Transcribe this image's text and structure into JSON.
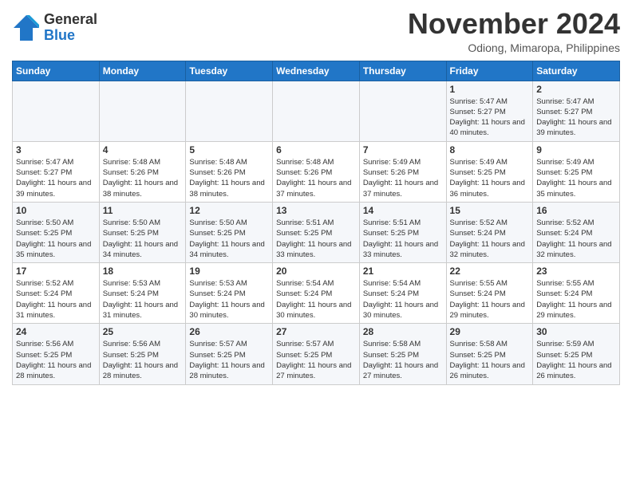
{
  "logo": {
    "general": "General",
    "blue": "Blue"
  },
  "header": {
    "month": "November 2024",
    "location": "Odiong, Mimaropa, Philippines"
  },
  "weekdays": [
    "Sunday",
    "Monday",
    "Tuesday",
    "Wednesday",
    "Thursday",
    "Friday",
    "Saturday"
  ],
  "weeks": [
    [
      {
        "day": "",
        "sunrise": "",
        "sunset": "",
        "daylight": ""
      },
      {
        "day": "",
        "sunrise": "",
        "sunset": "",
        "daylight": ""
      },
      {
        "day": "",
        "sunrise": "",
        "sunset": "",
        "daylight": ""
      },
      {
        "day": "",
        "sunrise": "",
        "sunset": "",
        "daylight": ""
      },
      {
        "day": "",
        "sunrise": "",
        "sunset": "",
        "daylight": ""
      },
      {
        "day": "1",
        "sunrise": "Sunrise: 5:47 AM",
        "sunset": "Sunset: 5:27 PM",
        "daylight": "Daylight: 11 hours and 40 minutes."
      },
      {
        "day": "2",
        "sunrise": "Sunrise: 5:47 AM",
        "sunset": "Sunset: 5:27 PM",
        "daylight": "Daylight: 11 hours and 39 minutes."
      }
    ],
    [
      {
        "day": "3",
        "sunrise": "Sunrise: 5:47 AM",
        "sunset": "Sunset: 5:27 PM",
        "daylight": "Daylight: 11 hours and 39 minutes."
      },
      {
        "day": "4",
        "sunrise": "Sunrise: 5:48 AM",
        "sunset": "Sunset: 5:26 PM",
        "daylight": "Daylight: 11 hours and 38 minutes."
      },
      {
        "day": "5",
        "sunrise": "Sunrise: 5:48 AM",
        "sunset": "Sunset: 5:26 PM",
        "daylight": "Daylight: 11 hours and 38 minutes."
      },
      {
        "day": "6",
        "sunrise": "Sunrise: 5:48 AM",
        "sunset": "Sunset: 5:26 PM",
        "daylight": "Daylight: 11 hours and 37 minutes."
      },
      {
        "day": "7",
        "sunrise": "Sunrise: 5:49 AM",
        "sunset": "Sunset: 5:26 PM",
        "daylight": "Daylight: 11 hours and 37 minutes."
      },
      {
        "day": "8",
        "sunrise": "Sunrise: 5:49 AM",
        "sunset": "Sunset: 5:25 PM",
        "daylight": "Daylight: 11 hours and 36 minutes."
      },
      {
        "day": "9",
        "sunrise": "Sunrise: 5:49 AM",
        "sunset": "Sunset: 5:25 PM",
        "daylight": "Daylight: 11 hours and 35 minutes."
      }
    ],
    [
      {
        "day": "10",
        "sunrise": "Sunrise: 5:50 AM",
        "sunset": "Sunset: 5:25 PM",
        "daylight": "Daylight: 11 hours and 35 minutes."
      },
      {
        "day": "11",
        "sunrise": "Sunrise: 5:50 AM",
        "sunset": "Sunset: 5:25 PM",
        "daylight": "Daylight: 11 hours and 34 minutes."
      },
      {
        "day": "12",
        "sunrise": "Sunrise: 5:50 AM",
        "sunset": "Sunset: 5:25 PM",
        "daylight": "Daylight: 11 hours and 34 minutes."
      },
      {
        "day": "13",
        "sunrise": "Sunrise: 5:51 AM",
        "sunset": "Sunset: 5:25 PM",
        "daylight": "Daylight: 11 hours and 33 minutes."
      },
      {
        "day": "14",
        "sunrise": "Sunrise: 5:51 AM",
        "sunset": "Sunset: 5:25 PM",
        "daylight": "Daylight: 11 hours and 33 minutes."
      },
      {
        "day": "15",
        "sunrise": "Sunrise: 5:52 AM",
        "sunset": "Sunset: 5:24 PM",
        "daylight": "Daylight: 11 hours and 32 minutes."
      },
      {
        "day": "16",
        "sunrise": "Sunrise: 5:52 AM",
        "sunset": "Sunset: 5:24 PM",
        "daylight": "Daylight: 11 hours and 32 minutes."
      }
    ],
    [
      {
        "day": "17",
        "sunrise": "Sunrise: 5:52 AM",
        "sunset": "Sunset: 5:24 PM",
        "daylight": "Daylight: 11 hours and 31 minutes."
      },
      {
        "day": "18",
        "sunrise": "Sunrise: 5:53 AM",
        "sunset": "Sunset: 5:24 PM",
        "daylight": "Daylight: 11 hours and 31 minutes."
      },
      {
        "day": "19",
        "sunrise": "Sunrise: 5:53 AM",
        "sunset": "Sunset: 5:24 PM",
        "daylight": "Daylight: 11 hours and 30 minutes."
      },
      {
        "day": "20",
        "sunrise": "Sunrise: 5:54 AM",
        "sunset": "Sunset: 5:24 PM",
        "daylight": "Daylight: 11 hours and 30 minutes."
      },
      {
        "day": "21",
        "sunrise": "Sunrise: 5:54 AM",
        "sunset": "Sunset: 5:24 PM",
        "daylight": "Daylight: 11 hours and 30 minutes."
      },
      {
        "day": "22",
        "sunrise": "Sunrise: 5:55 AM",
        "sunset": "Sunset: 5:24 PM",
        "daylight": "Daylight: 11 hours and 29 minutes."
      },
      {
        "day": "23",
        "sunrise": "Sunrise: 5:55 AM",
        "sunset": "Sunset: 5:24 PM",
        "daylight": "Daylight: 11 hours and 29 minutes."
      }
    ],
    [
      {
        "day": "24",
        "sunrise": "Sunrise: 5:56 AM",
        "sunset": "Sunset: 5:25 PM",
        "daylight": "Daylight: 11 hours and 28 minutes."
      },
      {
        "day": "25",
        "sunrise": "Sunrise: 5:56 AM",
        "sunset": "Sunset: 5:25 PM",
        "daylight": "Daylight: 11 hours and 28 minutes."
      },
      {
        "day": "26",
        "sunrise": "Sunrise: 5:57 AM",
        "sunset": "Sunset: 5:25 PM",
        "daylight": "Daylight: 11 hours and 28 minutes."
      },
      {
        "day": "27",
        "sunrise": "Sunrise: 5:57 AM",
        "sunset": "Sunset: 5:25 PM",
        "daylight": "Daylight: 11 hours and 27 minutes."
      },
      {
        "day": "28",
        "sunrise": "Sunrise: 5:58 AM",
        "sunset": "Sunset: 5:25 PM",
        "daylight": "Daylight: 11 hours and 27 minutes."
      },
      {
        "day": "29",
        "sunrise": "Sunrise: 5:58 AM",
        "sunset": "Sunset: 5:25 PM",
        "daylight": "Daylight: 11 hours and 26 minutes."
      },
      {
        "day": "30",
        "sunrise": "Sunrise: 5:59 AM",
        "sunset": "Sunset: 5:25 PM",
        "daylight": "Daylight: 11 hours and 26 minutes."
      }
    ]
  ]
}
